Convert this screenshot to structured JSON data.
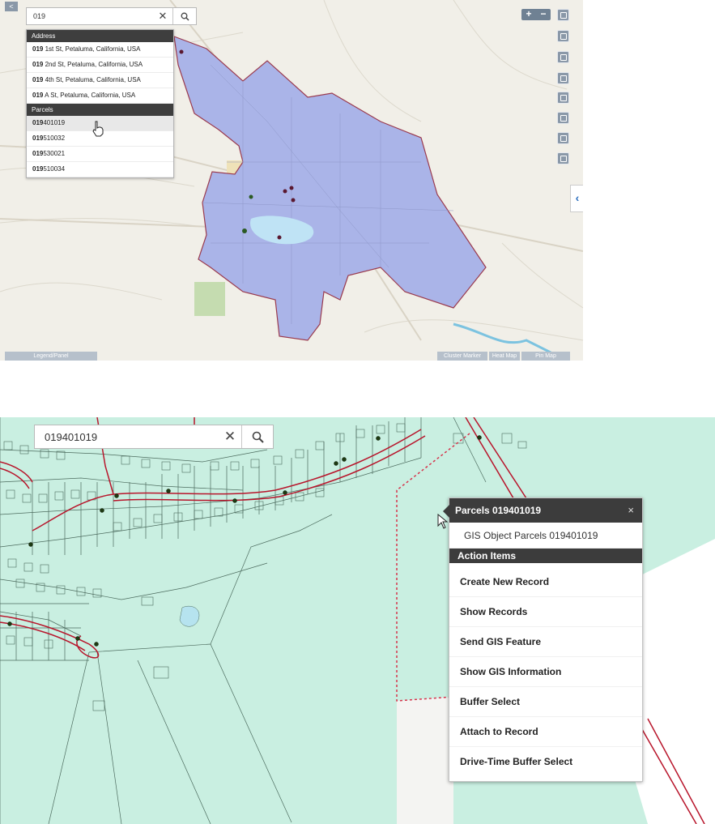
{
  "top_map": {
    "back_button": "<",
    "search": {
      "value": "019"
    },
    "dropdown": {
      "address_header": "Address",
      "address_items": [
        {
          "match": "019",
          "rest": " 1st St, Petaluma, California, USA"
        },
        {
          "match": "019",
          "rest": " 2nd St, Petaluma, California, USA"
        },
        {
          "match": "019",
          "rest": " 4th St, Petaluma, California, USA"
        },
        {
          "match": "019",
          "rest": " A St, Petaluma, California, USA"
        }
      ],
      "parcels_header": "Parcels",
      "parcel_items": [
        {
          "match": "019",
          "rest": "401019"
        },
        {
          "match": "019",
          "rest": "510032"
        },
        {
          "match": "019",
          "rest": "530021"
        },
        {
          "match": "019",
          "rest": "510034"
        }
      ]
    },
    "zoom_in": "+",
    "zoom_out": "−",
    "bottom_buttons": [
      "Legend/Panel",
      "Cluster Marker",
      "Heat Map",
      "Pin Map"
    ],
    "colors": {
      "parcel_fill": "#aab4e8",
      "parcel_border": "#9a3a4e",
      "land": "#f1efe8"
    }
  },
  "bottom_map": {
    "search": {
      "value": "019401019"
    },
    "popup": {
      "title": "Parcels 019401019",
      "close": "×",
      "subtitle": "GIS Object Parcels 019401019",
      "section_header": "Action Items",
      "actions": [
        "Create New Record",
        "Show Records",
        "Send GIS Feature",
        "Show GIS Information",
        "Buffer Select",
        "Attach to Record",
        "Drive-Time Buffer Select"
      ]
    },
    "colors": {
      "parcel_fill": "#c9efe1",
      "road": "#b8152b"
    }
  }
}
